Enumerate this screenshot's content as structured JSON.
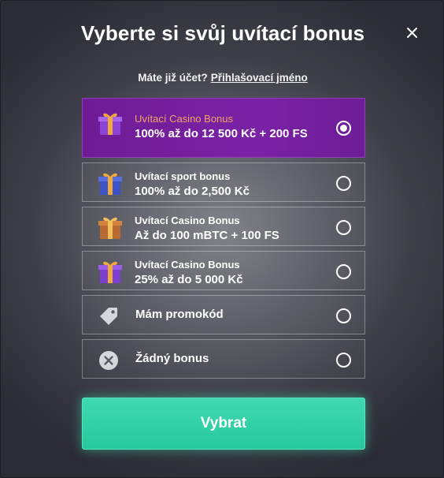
{
  "modal": {
    "title": "Vyberte si svůj uvítací bonus",
    "close_icon": "close-icon",
    "login_prompt": "Máte již účet?",
    "login_link": "Přihlašovací jméno"
  },
  "options": [
    {
      "title": "Uvítací Casino Bonus",
      "detail": "100% až do 12 500 Kč + 200 FS",
      "icon": "gift-icon",
      "selected": true
    },
    {
      "title": "Uvítací sport bonus",
      "detail": "100% až do 2,500 Kč",
      "icon": "gift-icon",
      "selected": false
    },
    {
      "title": "Uvítací Casino Bonus",
      "detail": "Až do 100 mBTC + 100 FS",
      "icon": "gift-icon",
      "selected": false
    },
    {
      "title": "Uvítací Casino Bonus",
      "detail": "25% až do 5 000 Kč",
      "icon": "gift-icon",
      "selected": false
    },
    {
      "label": "Mám promokód",
      "icon": "tag-icon",
      "selected": false
    },
    {
      "label": "Žádný bonus",
      "icon": "cancel-circle-icon",
      "selected": false
    }
  ],
  "submit_label": "Vybrat",
  "colors": {
    "selected_bg": "#7a22a6",
    "selected_title": "#f1a463",
    "accent_button": "#2fd0a5"
  }
}
